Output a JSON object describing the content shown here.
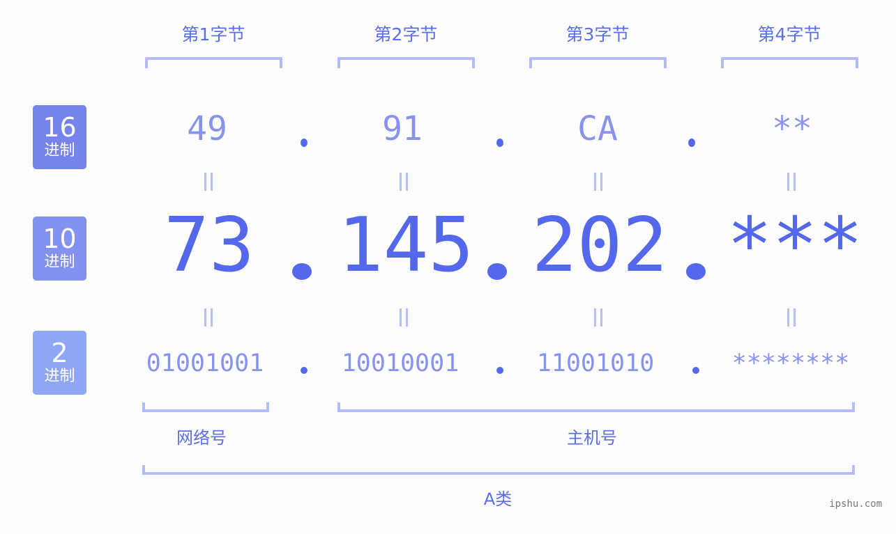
{
  "byte_headers": [
    "第1字节",
    "第2字节",
    "第3字节",
    "第4字节"
  ],
  "badges": {
    "hex": {
      "num": "16",
      "label": "进制",
      "color": "#7583ea"
    },
    "dec": {
      "num": "10",
      "label": "进制",
      "color": "#8492ef"
    },
    "bin": {
      "num": "2",
      "label": "进制",
      "color": "#8fa6f5"
    }
  },
  "hex_values": [
    "49",
    "91",
    "CA",
    "**"
  ],
  "dec_values": [
    "73",
    "145",
    "202",
    "***"
  ],
  "bin_values": [
    "01001001",
    "10010001",
    "11001010",
    "********"
  ],
  "equals_symbol": "=",
  "sections": {
    "network": "网络号",
    "host": "主机号",
    "class": "A类"
  },
  "watermark": "ipshu.com",
  "colors": {
    "accent": "#5468ec",
    "light": "#8793ec",
    "bracket": "#b3bcf7"
  }
}
